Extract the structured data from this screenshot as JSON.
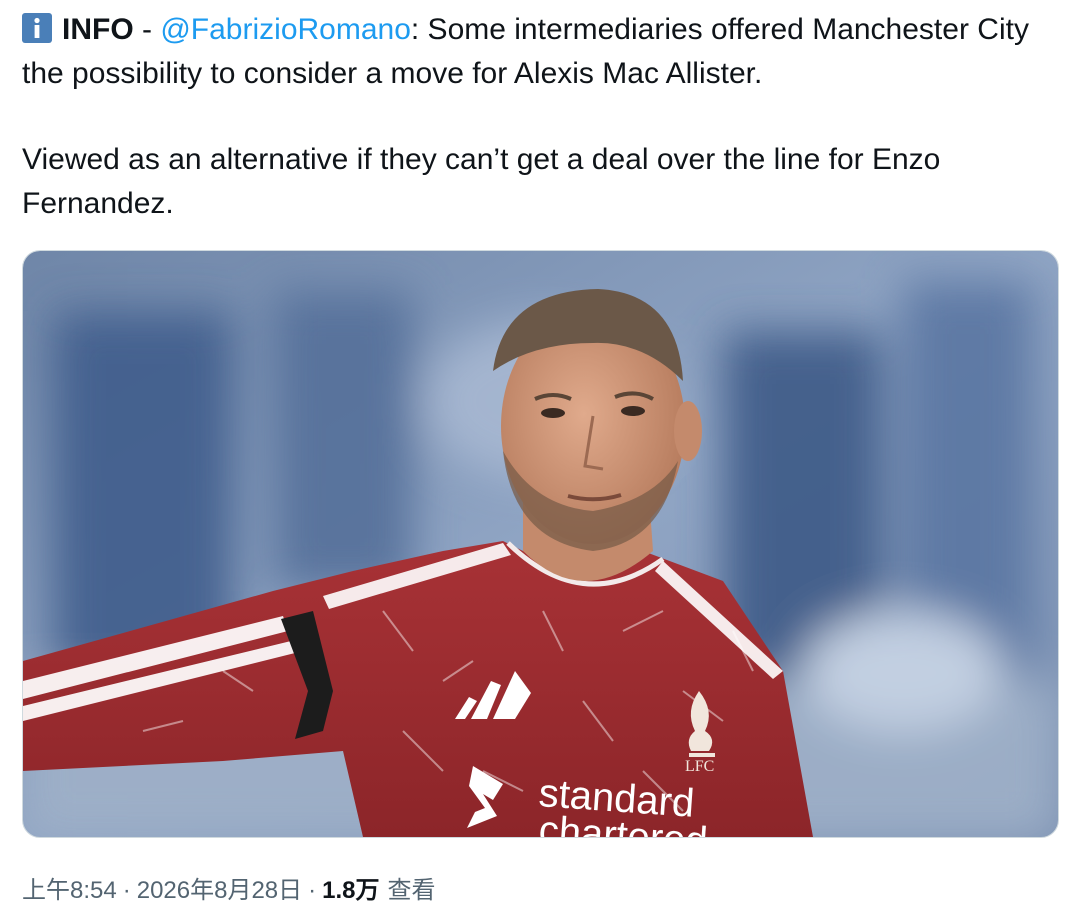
{
  "tweet": {
    "paragraph1": {
      "tag": "INFO",
      "separator": " - ",
      "mention": "@FabrizioRomano",
      "text": ": Some intermediaries offered Manchester City the possibility to consider a move for Alexis Mac Allister."
    },
    "paragraph2": "Viewed as an alternative if they can’t get a deal over the line for Enzo Fernandez.",
    "info_icon": "information-icon",
    "mention_color": "#1d9bf0"
  },
  "media": {
    "jersey_brand_text_1": "standard",
    "jersey_brand_text_2": "chartered",
    "crest_text": "LFC",
    "kit_color": "#9b2a2e"
  },
  "meta": {
    "time": "上午8:54",
    "date": "2026年8月28日",
    "views_count": "1.8万",
    "views_label": "查看"
  }
}
